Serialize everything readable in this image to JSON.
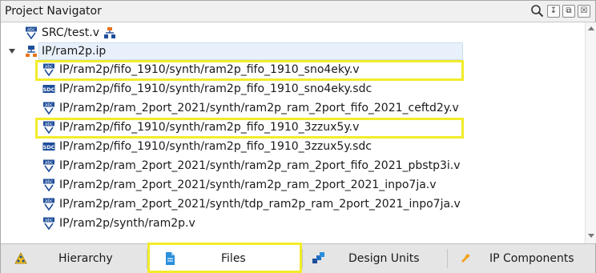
{
  "panel": {
    "title": "Project Navigator"
  },
  "toolbar": {
    "pin_label": "↧",
    "restore_label": "⧉",
    "close_label": "☒"
  },
  "tree": {
    "rows": [
      {
        "label": "SRC/test.v",
        "icon": "verilog-file-icon",
        "level": 1
      },
      {
        "label": "IP/ram2p.ip",
        "icon": "ip-module-icon",
        "level": 1,
        "expanded": true,
        "selected": true
      },
      {
        "label": "IP/ram2p/fifo_1910/synth/ram2p_fifo_1910_sno4eky.v",
        "icon": "verilog-file-icon",
        "level": 2,
        "highlighted": true
      },
      {
        "label": "IP/ram2p/fifo_1910/synth/ram2p_fifo_1910_sno4eky.sdc",
        "icon": "sdc-file-icon",
        "level": 2
      },
      {
        "label": "IP/ram2p/ram_2port_2021/synth/ram2p_ram_2port_fifo_2021_ceftd2y.v",
        "icon": "verilog-file-icon",
        "level": 2
      },
      {
        "label": "IP/ram2p/fifo_1910/synth/ram2p_fifo_1910_3zzux5y.v",
        "icon": "verilog-file-icon",
        "level": 2,
        "highlighted": true
      },
      {
        "label": "IP/ram2p/fifo_1910/synth/ram2p_fifo_1910_3zzux5y.sdc",
        "icon": "sdc-file-icon",
        "level": 2
      },
      {
        "label": "IP/ram2p/ram_2port_2021/synth/ram2p_ram_2port_fifo_2021_pbstp3i.v",
        "icon": "verilog-file-icon",
        "level": 2
      },
      {
        "label": "IP/ram2p/ram_2port_2021/synth/ram2p_ram_2port_2021_inpo7ja.v",
        "icon": "verilog-file-icon",
        "level": 2
      },
      {
        "label": "IP/ram2p/ram_2port_2021/synth/tdp_ram2p_ram_2port_2021_inpo7ja.v",
        "icon": "verilog-file-icon",
        "level": 2
      },
      {
        "label": "IP/ram2p/synth/ram2p.v",
        "icon": "verilog-file-icon",
        "level": 2
      }
    ]
  },
  "tabs": [
    {
      "label": "Hierarchy",
      "icon": "hierarchy-icon"
    },
    {
      "label": "Files",
      "icon": "document-icon",
      "active": true
    },
    {
      "label": "Design Units",
      "icon": "design-units-icon"
    },
    {
      "label": "IP Components",
      "icon": "ip-components-icon"
    }
  ],
  "colors": {
    "highlight": "#f2ec2a",
    "selection": "#e8f1fb",
    "tab_active": "#ffffff",
    "tab_bar": "#e5e5e5"
  }
}
